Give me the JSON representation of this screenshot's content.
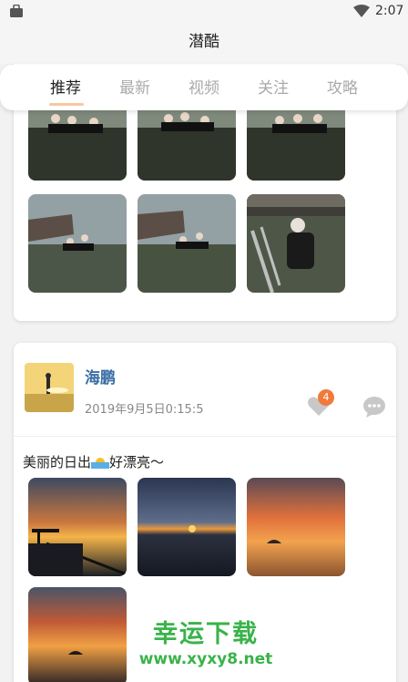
{
  "status_bar": {
    "time": "2:07"
  },
  "header": {
    "title": "潜酷"
  },
  "tabs": [
    "推荐",
    "最新",
    "视频",
    "关注",
    "攻略"
  ],
  "active_tab": "推荐",
  "post1": {
    "photos": [
      "diver-group",
      "diver-group",
      "diver-group",
      "diver-pier",
      "diver-pier",
      "diver-ladder"
    ]
  },
  "post2": {
    "username": "海鹏",
    "time": "2019年9月5日0:15:5",
    "likes": "4",
    "text_before": "美丽的日出",
    "text_after": "好漂亮～",
    "photos": [
      "sunrise-pier",
      "sunrise-sea",
      "sunrise-island",
      "sunrise-clouds"
    ]
  },
  "watermark": {
    "main": "幸运下载",
    "url": "www.xyxy8.net"
  },
  "icons": {
    "status": [
      "bag-icon",
      "wifi-icon",
      "battery-icon"
    ],
    "actions": [
      "heart-icon",
      "comment-icon"
    ]
  },
  "colors": {
    "accent": "#f07a3c",
    "username": "#3a6ea5",
    "watermark": "#39b34a"
  }
}
